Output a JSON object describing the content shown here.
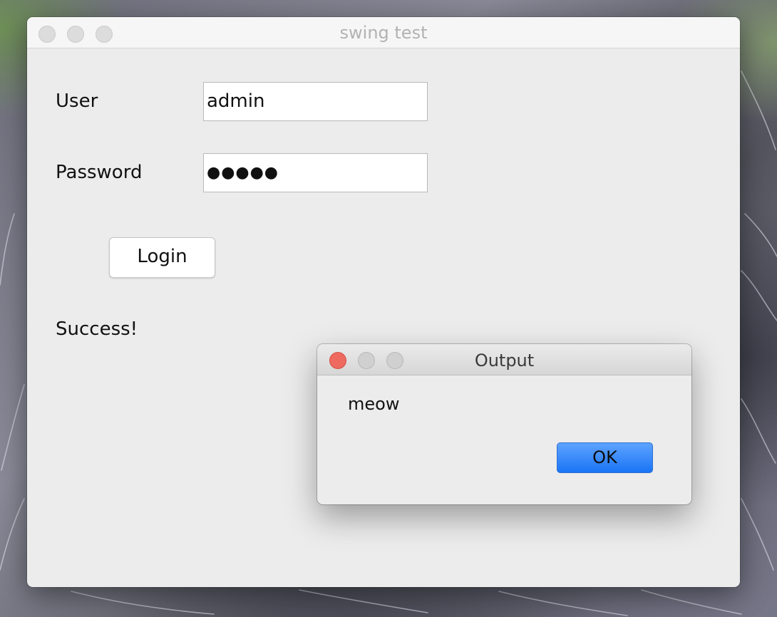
{
  "main_window": {
    "title": "swing test",
    "user_label": "User",
    "user_value": "admin",
    "password_label": "Password",
    "password_value": "●●●●●",
    "login_label": "Login",
    "status_text": "Success!"
  },
  "dialog": {
    "title": "Output",
    "message": "meow",
    "ok_label": "OK"
  },
  "colors": {
    "window_bg": "#ececec",
    "dialog_close": "#ee6a5f",
    "ok_button": "#1a74f5"
  }
}
